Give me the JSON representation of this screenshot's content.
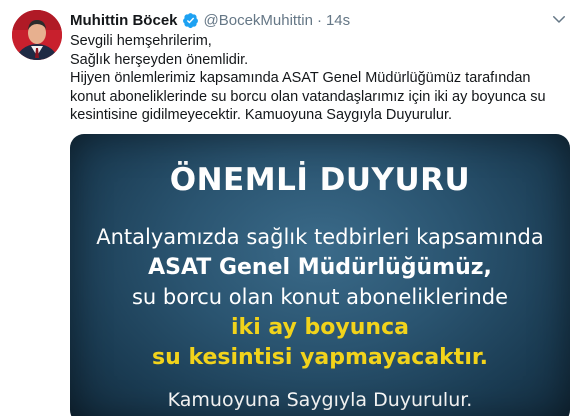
{
  "tweet": {
    "display_name": "Muhittin Böcek",
    "handle": "@BocekMuhittin",
    "separator": "·",
    "time": "14s",
    "verified": true,
    "body_lines": [
      "Sevgili hemşehrilerim,",
      "Sağlık herşeyden önemlidir.",
      "Hijyen önlemlerimiz kapsamında ASAT Genel Müdürlüğümüz tarafından",
      "konut aboneliklerinde su borcu olan vatandaşlarımız için iki ay boyunca su",
      "kesintisine gidilmeyecektir. Kamuoyuna Saygıyla Duyurulur."
    ]
  },
  "media": {
    "title": "ÖNEMLİ DUYURU",
    "lines": [
      "Antalyamızda sağlık tedbirleri kapsamında",
      "ASAT Genel Müdürlüğümüz,",
      "su borcu olan konut aboneliklerinde",
      "iki ay boyunca",
      "su kesintisi yapmayacaktır.",
      "Kamuoyuna Saygıyla Duyurulur."
    ]
  },
  "colors": {
    "text_primary": "#14171a",
    "text_secondary": "#657786",
    "verified_blue": "#1da1f2",
    "highlight_yellow": "#f2d31b",
    "media_bg": "#2a5470"
  },
  "icons": {
    "verified": "verified-badge-icon",
    "chevron": "chevron-down-icon",
    "avatar": "profile-photo"
  }
}
